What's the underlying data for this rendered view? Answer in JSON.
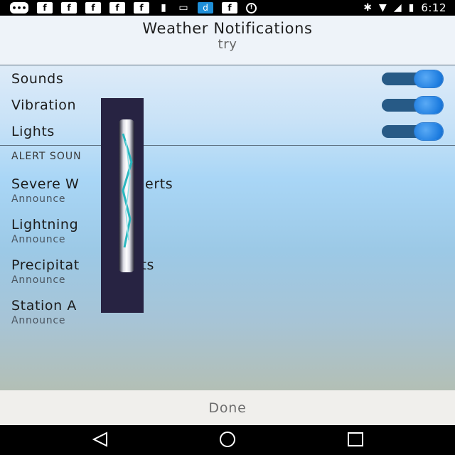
{
  "status_bar": {
    "time": "6:12",
    "left_icons": [
      {
        "name": "messages-icon",
        "glyph": "•••",
        "style": "pill"
      },
      {
        "name": "facebook-icon",
        "glyph": "f",
        "style": "box"
      },
      {
        "name": "facebook-icon-2",
        "glyph": "f",
        "style": "box"
      },
      {
        "name": "facebook-icon-3",
        "glyph": "f",
        "style": "box"
      },
      {
        "name": "facebook-icon-4",
        "glyph": "f",
        "style": "box"
      },
      {
        "name": "facebook-icon-5",
        "glyph": "f",
        "style": "box"
      },
      {
        "name": "keyhole-icon",
        "glyph": "▮",
        "style": "plain"
      },
      {
        "name": "card-icon",
        "glyph": "▭",
        "style": "plain"
      },
      {
        "name": "dictionary-icon",
        "glyph": "d",
        "style": "dict"
      },
      {
        "name": "facebook-icon-6",
        "glyph": "f",
        "style": "box"
      },
      {
        "name": "alert-circle-icon",
        "glyph": "!",
        "style": "ring"
      }
    ],
    "right_icons": [
      {
        "name": "bluetooth-icon",
        "glyph": "✱"
      },
      {
        "name": "wifi-icon",
        "glyph": "▼"
      },
      {
        "name": "signal-icon",
        "glyph": "◢"
      },
      {
        "name": "battery-charging-icon",
        "glyph": "▮"
      }
    ]
  },
  "dialog": {
    "title": "Weather Notifications",
    "subtitle": "try"
  },
  "toggles": [
    {
      "label": "Sounds",
      "on": true
    },
    {
      "label": "Vibration",
      "on": true
    },
    {
      "label": "Lights",
      "on": true
    }
  ],
  "section_header": "ALERT SOUN",
  "alerts": [
    {
      "title": "Severe W     her Alerts",
      "subtitle": "Announce"
    },
    {
      "title": "Lightning       rts",
      "subtitle": "Announce"
    },
    {
      "title": "Precipitat       Alerts",
      "subtitle": "Announce"
    },
    {
      "title": "Station A",
      "subtitle": "Announce"
    }
  ],
  "done_label": "Done",
  "colors": {
    "switch_track": "#275a86",
    "switch_thumb": "#1e7de0",
    "overlay": "#272342",
    "overlay_stripe": "#2ab8c0"
  }
}
